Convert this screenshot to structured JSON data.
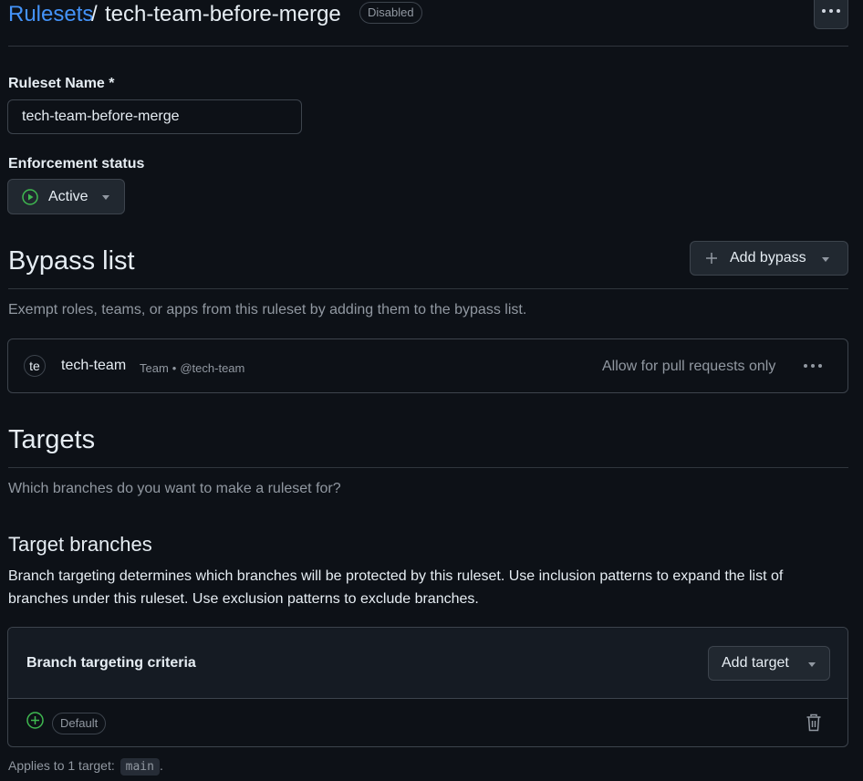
{
  "header": {
    "breadcrumb_link": "Rulesets",
    "separator": "/",
    "ruleset_name": "tech-team-before-merge",
    "state_badge": "Disabled"
  },
  "form": {
    "name_label": "Ruleset Name *",
    "name_value": "tech-team-before-merge",
    "enforcement_label": "Enforcement status",
    "enforcement_value": "Active"
  },
  "bypass": {
    "title": "Bypass list",
    "add_button": "Add bypass",
    "description": "Exempt roles, teams, or apps from this ruleset by adding them to the bypass list.",
    "items": [
      {
        "avatar_text": "te",
        "name": "tech-team",
        "type": "Team",
        "handle": "@tech-team",
        "mode": "Allow for pull requests only"
      }
    ]
  },
  "targets": {
    "title": "Targets",
    "description": "Which branches do you want to make a ruleset for?",
    "branches_title": "Target branches",
    "branches_description": "Branch targeting determines which branches will be protected by this ruleset. Use inclusion patterns to expand the list of branches under this ruleset. Use exclusion patterns to exclude branches.",
    "criteria_title": "Branch targeting criteria",
    "add_target_button": "Add target",
    "criteria_items": [
      {
        "badge": "Default",
        "icon": "plus-circle-icon"
      }
    ],
    "applies_prefix": "Applies to 1 target:",
    "applies_code": "main",
    "applies_suffix": "."
  },
  "colors": {
    "background": "#0d1117",
    "link": "#4493f8",
    "success": "#3fb950",
    "muted": "#9198a1",
    "border": "#3d444d"
  }
}
